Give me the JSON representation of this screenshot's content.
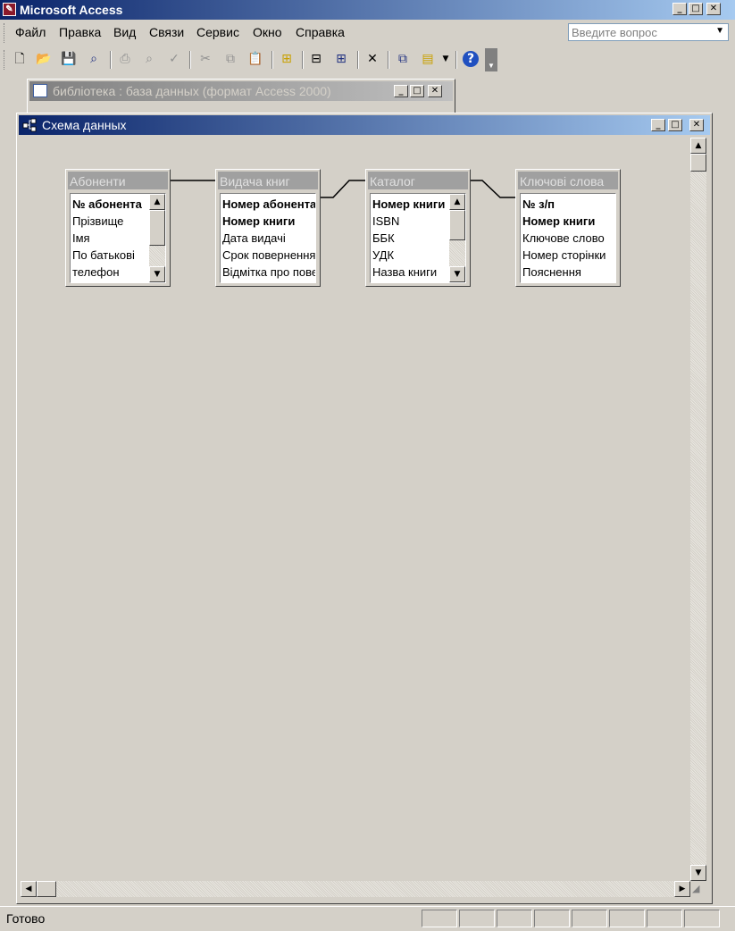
{
  "app": {
    "title": "Microsoft Access"
  },
  "menu": {
    "items": [
      "Файл",
      "Правка",
      "Вид",
      "Связи",
      "Сервис",
      "Окно",
      "Справка"
    ]
  },
  "ask": {
    "placeholder": "Введите вопрос"
  },
  "db_window": {
    "title": "библіотека : база данных (формат Access 2000)"
  },
  "schema_window": {
    "title": "Схема данных"
  },
  "tables": [
    {
      "name": "Абоненти",
      "fields": [
        {
          "label": "№ абонента",
          "pk": true
        },
        {
          "label": "Прізвище",
          "pk": false
        },
        {
          "label": "Імя",
          "pk": false
        },
        {
          "label": "По батькові",
          "pk": false
        },
        {
          "label": "телефон",
          "pk": false
        }
      ]
    },
    {
      "name": "Видача книг",
      "fields": [
        {
          "label": "Номер абонента",
          "pk": true
        },
        {
          "label": "Номер книги",
          "pk": true
        },
        {
          "label": "Дата видачі",
          "pk": false
        },
        {
          "label": "Срок повернення",
          "pk": false
        },
        {
          "label": "Відмітка про повер",
          "pk": false
        }
      ]
    },
    {
      "name": "Каталог",
      "fields": [
        {
          "label": "Номер книги",
          "pk": true
        },
        {
          "label": "ISBN",
          "pk": false
        },
        {
          "label": "ББК",
          "pk": false
        },
        {
          "label": "УДК",
          "pk": false
        },
        {
          "label": "Назва книги",
          "pk": false
        }
      ]
    },
    {
      "name": "Ключові слова",
      "fields": [
        {
          "label": "№ з/п",
          "pk": true
        },
        {
          "label": "Номер книги",
          "pk": true
        },
        {
          "label": "Ключове слово",
          "pk": false
        },
        {
          "label": "Номер сторінки",
          "pk": false
        },
        {
          "label": "Пояснення",
          "pk": false
        }
      ]
    }
  ],
  "status": {
    "text": "Готово"
  },
  "colors": {
    "active_title": "#0a246a",
    "inactive_title": "#808080",
    "face": "#d4d0c8"
  }
}
